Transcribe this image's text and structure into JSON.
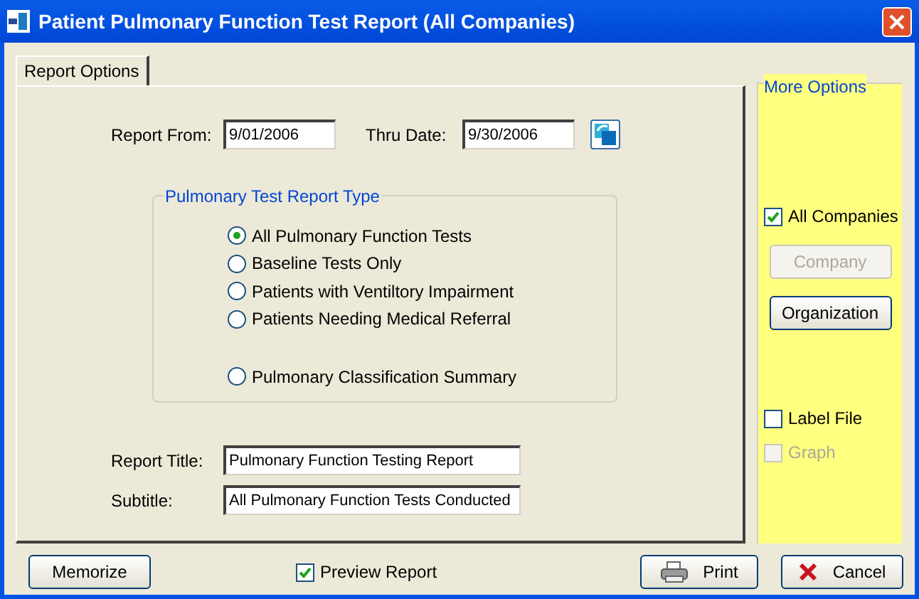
{
  "window": {
    "title": "Patient Pulmonary Function Test Report (All Companies)"
  },
  "tabs": [
    {
      "label": "Report Options",
      "selected": true
    }
  ],
  "date_range": {
    "from_label": "Report From:",
    "from_value": "9/01/2006",
    "thru_label": "Thru Date:",
    "thru_value": "9/30/2006"
  },
  "report_type": {
    "title": "Pulmonary Test Report Type",
    "options": [
      {
        "label": "All Pulmonary Function Tests",
        "selected": true
      },
      {
        "label": "Baseline Tests Only",
        "selected": false
      },
      {
        "label": "Patients with Ventiltory Impairment",
        "selected": false
      },
      {
        "label": "Patients Needing Medical Referral",
        "selected": false
      },
      {
        "label": "Pulmonary Classification Summary",
        "selected": false
      }
    ]
  },
  "titles": [
    {
      "label": "Report Title:",
      "value": "Pulmonary Function Testing Report"
    },
    {
      "label": "Subtitle:",
      "value": "All Pulmonary Function Tests Conducted"
    }
  ],
  "more_options": {
    "title": "More Options",
    "all_companies": {
      "label": "All Companies",
      "checked": true,
      "disabled": false
    },
    "buttons": [
      {
        "label": "Company",
        "disabled": true
      },
      {
        "label": "Organization",
        "disabled": false
      }
    ],
    "label_file": {
      "label": "Label File",
      "checked": false,
      "disabled": false
    },
    "graph": {
      "label": "Graph",
      "checked": false,
      "disabled": true
    }
  },
  "footer": {
    "memorize": "Memorize",
    "preview": {
      "label": "Preview Report",
      "checked": true
    },
    "print": "Print",
    "cancel": "Cancel"
  }
}
